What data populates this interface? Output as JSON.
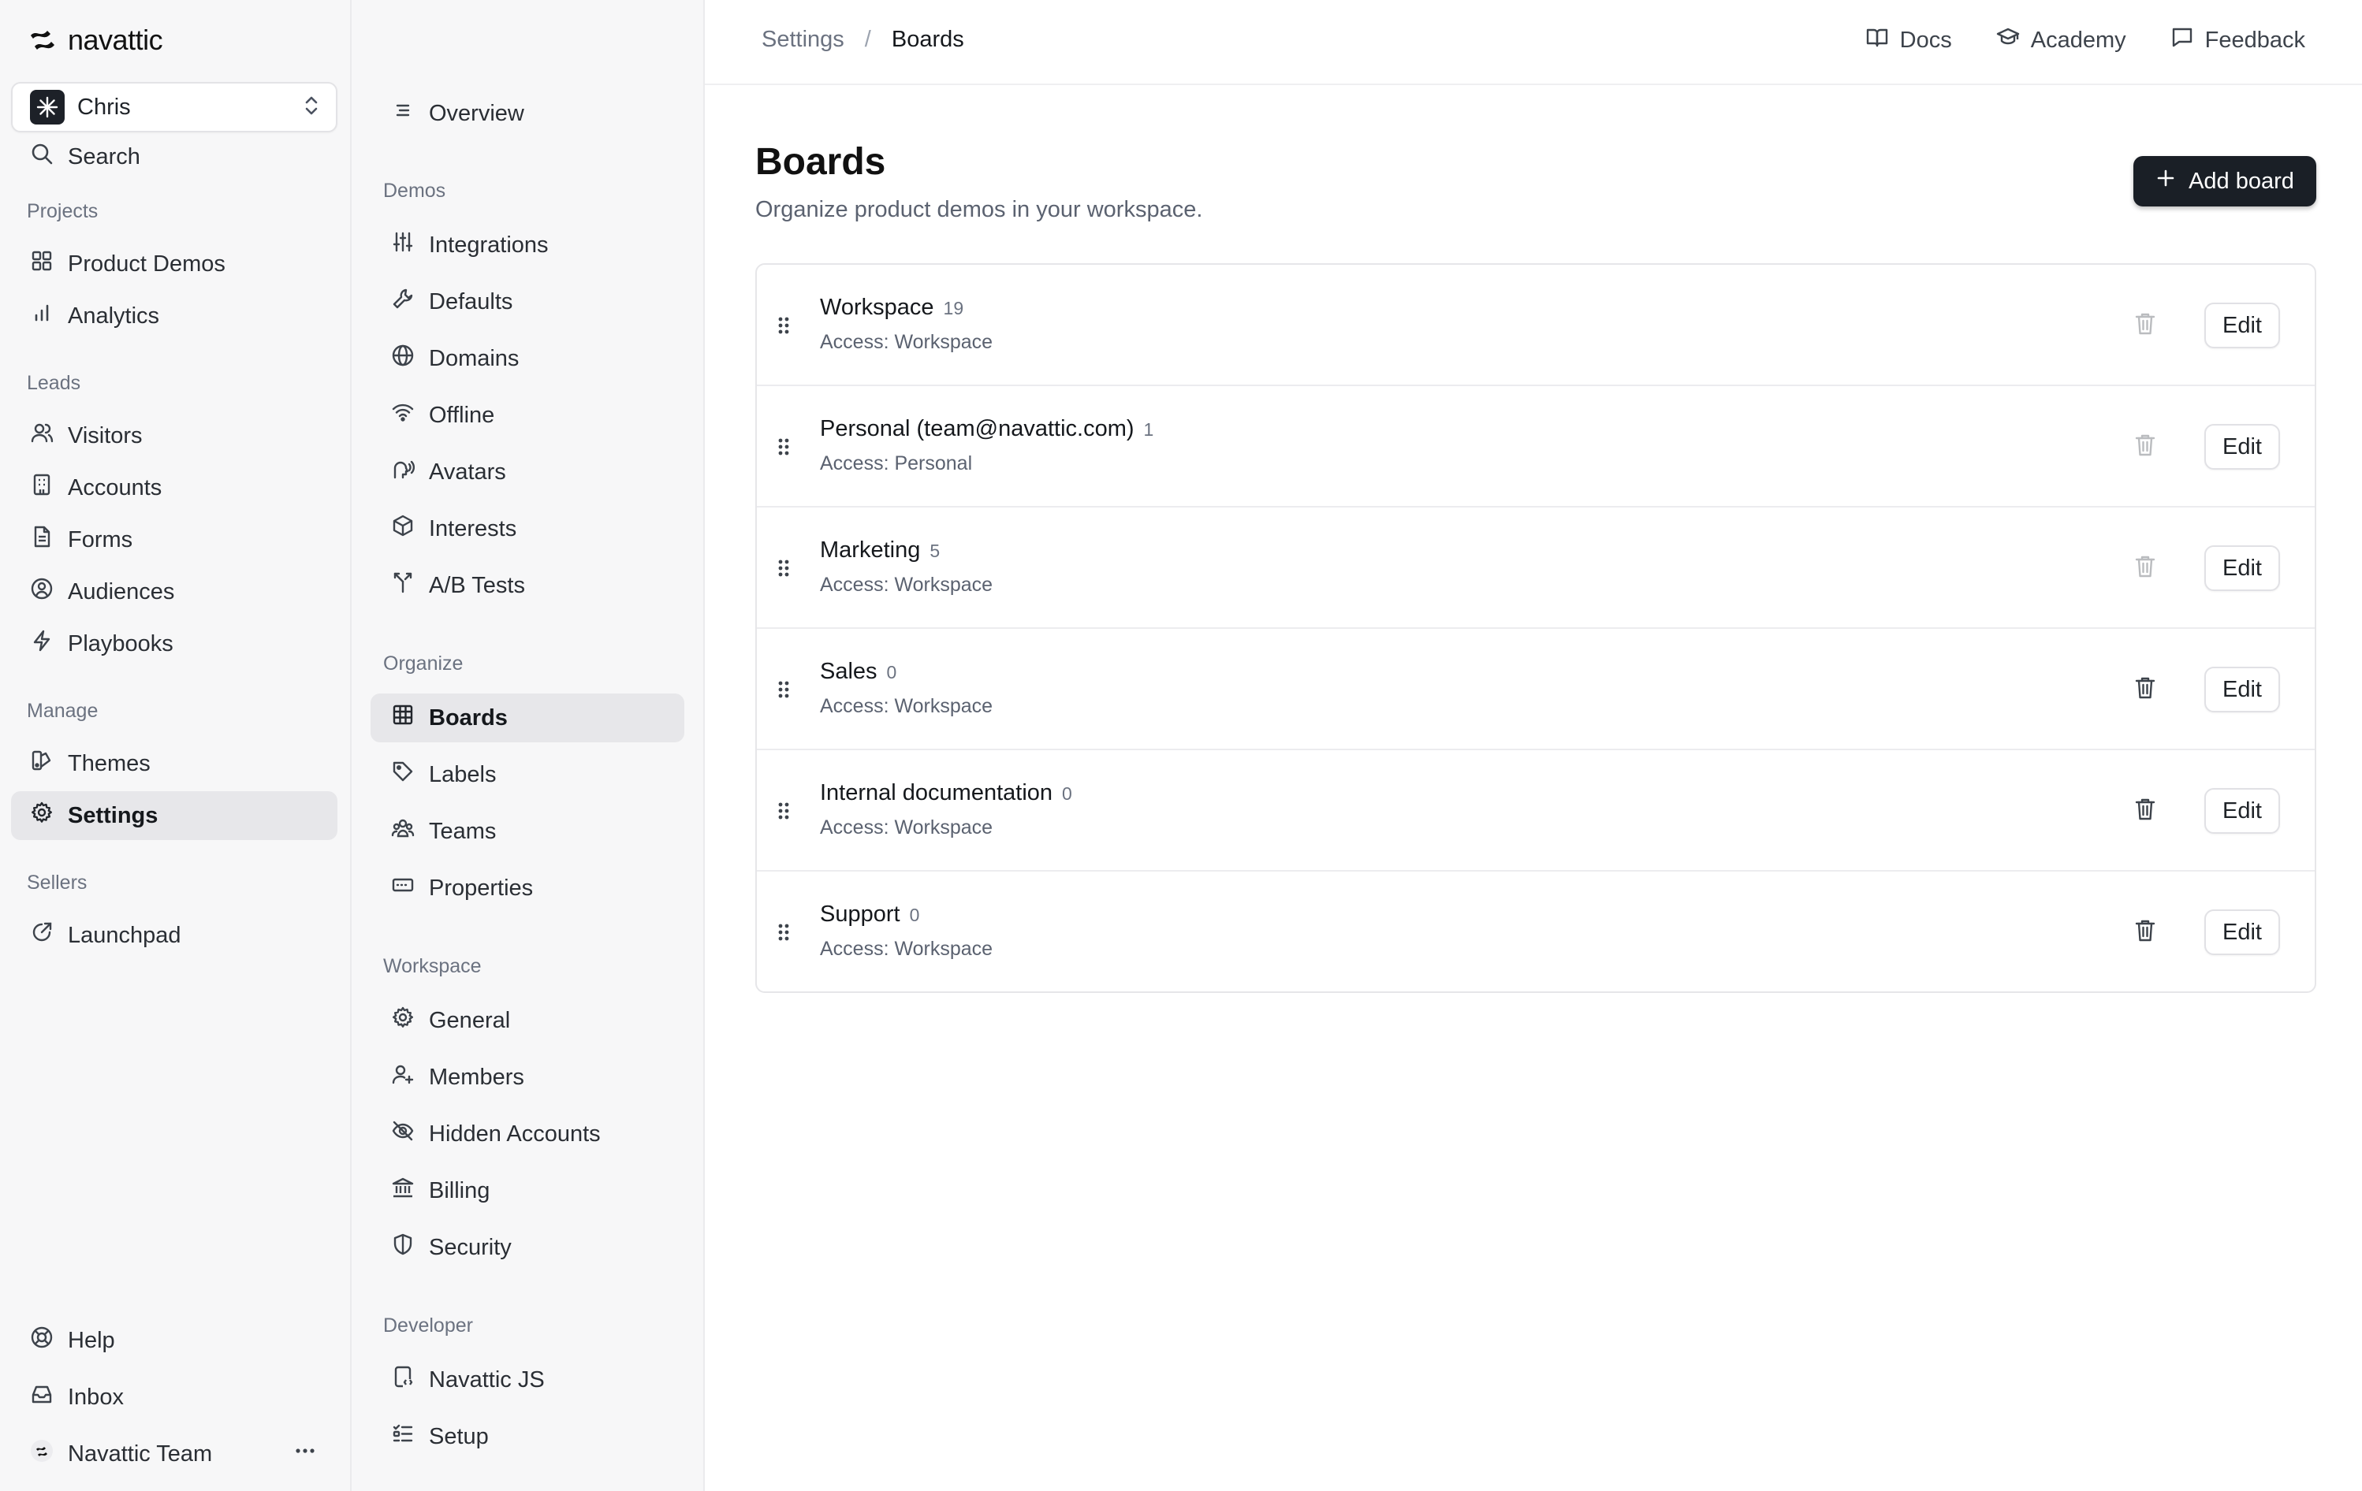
{
  "brand": {
    "name": "navattic"
  },
  "workspace_switcher": {
    "name": "Chris"
  },
  "sidebar": {
    "search_label": "Search",
    "sections": {
      "projects": "Projects",
      "leads": "Leads",
      "manage": "Manage",
      "sellers": "Sellers"
    },
    "items": {
      "product_demos": "Product Demos",
      "analytics": "Analytics",
      "visitors": "Visitors",
      "accounts": "Accounts",
      "forms": "Forms",
      "audiences": "Audiences",
      "playbooks": "Playbooks",
      "themes": "Themes",
      "settings": "Settings",
      "launchpad": "Launchpad"
    },
    "bottom": {
      "help": "Help",
      "inbox": "Inbox",
      "team": "Navattic Team"
    }
  },
  "subnav": {
    "overview": "Overview",
    "sections": {
      "demos": "Demos",
      "organize": "Organize",
      "workspace": "Workspace",
      "developer": "Developer"
    },
    "items": {
      "integrations": "Integrations",
      "defaults": "Defaults",
      "domains": "Domains",
      "offline": "Offline",
      "avatars": "Avatars",
      "interests": "Interests",
      "ab_tests": "A/B Tests",
      "boards": "Boards",
      "labels": "Labels",
      "teams": "Teams",
      "properties": "Properties",
      "general": "General",
      "members": "Members",
      "hidden_accounts": "Hidden Accounts",
      "billing": "Billing",
      "security": "Security",
      "navattic_js": "Navattic JS",
      "setup": "Setup"
    }
  },
  "header": {
    "breadcrumb": [
      "Settings",
      "Boards"
    ],
    "breadcrumb_separator": "/",
    "links": {
      "docs": "Docs",
      "academy": "Academy",
      "feedback": "Feedback"
    }
  },
  "page": {
    "title": "Boards",
    "subtitle": "Organize product demos in your workspace.",
    "add_button": "Add board",
    "edit_label": "Edit"
  },
  "boards": [
    {
      "name": "Workspace",
      "count": "19",
      "access": "Access: Workspace",
      "deletable": false
    },
    {
      "name": "Personal (team@navattic.com)",
      "count": "1",
      "access": "Access: Personal",
      "deletable": false
    },
    {
      "name": "Marketing",
      "count": "5",
      "access": "Access: Workspace",
      "deletable": false
    },
    {
      "name": "Sales",
      "count": "0",
      "access": "Access: Workspace",
      "deletable": true
    },
    {
      "name": "Internal documentation",
      "count": "0",
      "access": "Access: Workspace",
      "deletable": true
    },
    {
      "name": "Support",
      "count": "0",
      "access": "Access: Workspace",
      "deletable": true
    }
  ],
  "colors": {
    "sidebar_bg": "#f7f7f8",
    "active_bg": "#e7e7ea",
    "primary_button": "#1a1f26",
    "border": "#e6e6e9",
    "muted_text": "#6b7280"
  }
}
